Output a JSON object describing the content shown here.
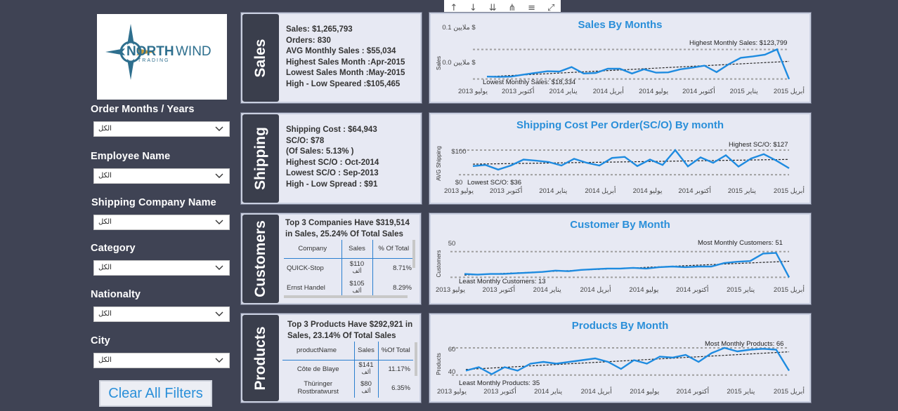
{
  "logo": {
    "brand_north": "NORTH",
    "brand_wind": "WIND",
    "brand_sub": "TRADING",
    "logo_color": "#2e6f8e"
  },
  "filters": [
    {
      "label": "Order Months / Years",
      "value": "الكل"
    },
    {
      "label": "Employee Name",
      "value": "الكل"
    },
    {
      "label": "Shipping Company Name",
      "value": "الكل"
    },
    {
      "label": "Category",
      "value": "الكل"
    },
    {
      "label": "Nationalty",
      "value": "الكل"
    },
    {
      "label": "City",
      "value": "الكل"
    }
  ],
  "clear_button": "Clear All Filters",
  "toolbar_icons": [
    "arrow-up-icon",
    "arrow-down-icon",
    "double-arrow-down-icon",
    "expand-hierarchy-icon",
    "filter-icon",
    "focus-mode-icon"
  ],
  "sales": {
    "tab": "Sales",
    "kpis": [
      "Sales: $1,265,793",
      "Orders: 830",
      "AVG Monthly Sales : $55,034",
      "Highest Sales Month :Apr-2015",
      "Lowest Sales Month :May-2015",
      "High - Low Speared :$105,465"
    ]
  },
  "shipping": {
    "tab": "Shipping",
    "kpis": [
      "Shipping Cost : $64,943",
      "SC/O: $78",
      "(Of Sales:  5.13% )",
      "Highest SC/O : Oct-2014",
      "Lowest SC/O : Sep-2013",
      "High - Low Spread : $91"
    ]
  },
  "customers": {
    "tab": "Customers",
    "headline": [
      "Top 3 Companies Have $319,514",
      "in Sales, 25.24% Of Total Sales"
    ],
    "columns": [
      "Company",
      "Sales",
      "% Of Total"
    ],
    "rows": [
      {
        "name": "QUICK-Stop",
        "sales": "$110",
        "unit": "ألف",
        "pct": "8.71%"
      },
      {
        "name": "Ernst Handel",
        "sales": "$105",
        "unit": "ألف",
        "pct": "8.29%"
      }
    ]
  },
  "products": {
    "tab": "Products",
    "headline": [
      "Top 3 Products Have $292,921 in",
      "Sales, 23.14% Of Total Sales"
    ],
    "columns": [
      "productName",
      "Sales",
      "%Of Total"
    ],
    "rows": [
      {
        "name": "Côte de Blaye",
        "sales": "$141",
        "unit": "ألف",
        "pct": "11.17%"
      },
      {
        "name": "Thüringer Rostbratwurst",
        "sales": "$80",
        "unit": "ألف",
        "pct": "6.35%"
      }
    ]
  },
  "x_ticks": [
    "يوليو 2013",
    "أكتوبر 2013",
    "يناير 2014",
    "أبريل 2014",
    "يوليو 2014",
    "أكتوبر 2014",
    "يناير 2015",
    "أبريل 2015"
  ],
  "chart_data": [
    {
      "type": "line",
      "title": "Sales By Months",
      "ylabel": "Sales",
      "y_ticks": [
        "0.1 ملايين $",
        "0.0 ملايين $"
      ],
      "ylim": [
        0,
        0.13
      ],
      "values": [
        0.027,
        0.026,
        0.027,
        0.034,
        0.04,
        0.046,
        0.045,
        0.061,
        0.038,
        0.04,
        0.055,
        0.055,
        0.038,
        0.053,
        0.041,
        0.042,
        0.053,
        0.059,
        0.066,
        0.043,
        0.071,
        0.094,
        0.099,
        0.105,
        0.124,
        0.018
      ],
      "ref_high": 0.1238,
      "ref_low": 0.0183,
      "annotations": [
        "Highest Monthly Sales: $123,799",
        "Lowest Monthly Sales: $18,334"
      ],
      "line_color": "#1e8be0"
    },
    {
      "type": "line",
      "title": "Shipping Cost Per Order(SC/O) By month",
      "ylabel": "AVG Shipping",
      "y_ticks": [
        "$100",
        "$0"
      ],
      "ylim": [
        0,
        140
      ],
      "values": [
        68,
        72,
        55,
        70,
        92,
        88,
        83,
        70,
        95,
        80,
        70,
        98,
        102,
        68,
        92,
        72,
        127,
        67,
        100,
        80,
        108,
        66,
        96,
        112,
        88,
        60
      ],
      "ref_high": 127,
      "ref_low": 36,
      "annotations": [
        "Highest SC/O: $127",
        "Lowest SC/O: $36"
      ],
      "line_color": "#1e8be0"
    },
    {
      "type": "line",
      "title": "Customer By Month",
      "ylabel": "Customers",
      "y_ticks": [
        "50"
      ],
      "ylim": [
        0,
        60
      ],
      "values": [
        18,
        17,
        18,
        18,
        19,
        20,
        21,
        23,
        22,
        24,
        25,
        26,
        26,
        27,
        26,
        28,
        29,
        28,
        29,
        29,
        34,
        36,
        37,
        48,
        49,
        13
      ],
      "ref_high": 51,
      "ref_low": 13,
      "annotations": [
        "Most Monthly Customers: 51",
        "Least Monthly Customers: 13"
      ],
      "line_color": "#1e8be0"
    },
    {
      "type": "line",
      "title": "Products By Month",
      "ylabel": "Products",
      "y_ticks": [
        "60",
        "40"
      ],
      "ylim": [
        30,
        70
      ],
      "values": [
        40,
        44,
        36,
        44,
        40,
        48,
        50,
        48,
        50,
        52,
        54,
        50,
        42,
        52,
        48,
        56,
        55,
        58,
        50,
        60,
        66,
        62,
        64,
        65,
        64,
        40
      ],
      "ref_high": 66,
      "ref_low": 35,
      "annotations": [
        "Most Monthly Products: 66",
        "Least Monthly Products: 35"
      ],
      "line_color": "#1e8be0"
    }
  ]
}
